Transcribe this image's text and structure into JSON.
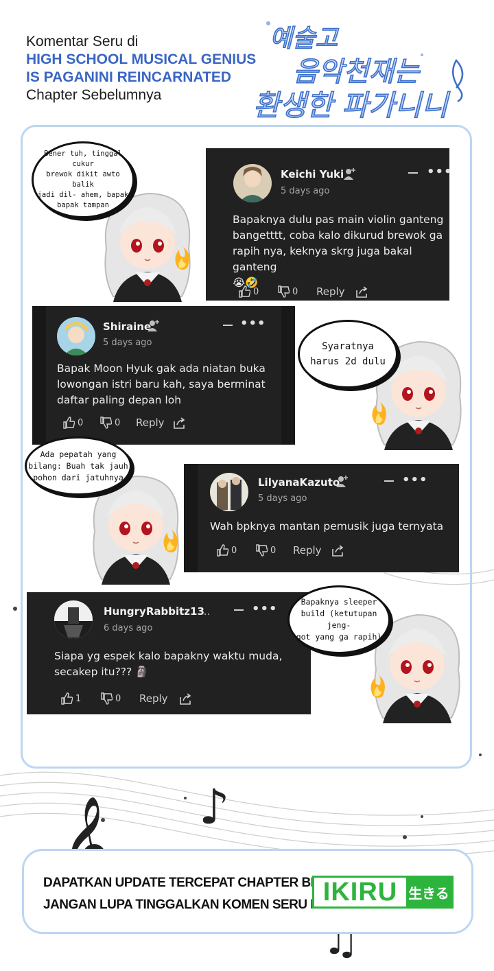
{
  "header": {
    "line1": "Komentar Seru di",
    "series_line1": "HIGH SCHOOL MUSICAL GENIUS",
    "series_line2": "IS PAGANINI REINCARNATED",
    "line4": "Chapter Sebelumnya",
    "logo_line1": "예술고",
    "logo_line2": "음악천재는",
    "logo_line3": "환생한 파가니니"
  },
  "comments": [
    {
      "username": "Keichi Yuki",
      "age": "5 days ago",
      "text_lines": [
        "Bapaknya dulu pas main violin ganteng",
        "bangetttt, coba kalo dikurud brewok ga",
        "rapih nya, keknya skrg juga bakal ganteng",
        "😭🤣"
      ],
      "likes": "0",
      "dislikes": "0",
      "reply_label": "Reply"
    },
    {
      "username": "Shiraine",
      "age": "5 days ago",
      "text_lines": [
        "Bapak Moon Hyuk gak ada niatan buka",
        "lowongan istri baru kah, saya berminat",
        "daftar paling depan loh"
      ],
      "likes": "0",
      "dislikes": "0",
      "reply_label": "Reply"
    },
    {
      "username": "LilyanaKazuto",
      "age": "5 days ago",
      "text_lines": [
        "Wah bpknya mantan pemusik juga ternyata"
      ],
      "likes": "0",
      "dislikes": "0",
      "reply_label": "Reply"
    },
    {
      "username": "HungryRabbitz13",
      "username_suffix": "...",
      "age": "6 days ago",
      "text_lines": [
        "Siapa yg espek kalo bapakny waktu muda,",
        "secakep itu??? 🗿"
      ],
      "likes": "1",
      "dislikes": "0",
      "reply_label": "Reply"
    }
  ],
  "bubbles": [
    {
      "lines": [
        "Bener tuh, tinggal cukur",
        "brewok dikit awto balik",
        "jadi dil- ahem, bapak",
        "bapak tampan"
      ]
    },
    {
      "lines": [
        "Syaratnya",
        "harus 2d dulu"
      ]
    },
    {
      "lines": [
        "Ada pepatah yang",
        "bilang: Buah tak jauh",
        "pohon dari jatuhnya"
      ]
    },
    {
      "lines": [
        "Bapaknya sleeper",
        "build (ketutupan jeng-",
        "got yang ga rapih)"
      ]
    }
  ],
  "footer": {
    "line1": "DAPATKAN UPDATE TERCEPAT CHAPTER BERIKUTNYA DI",
    "line2": "JANGAN LUPA TINGGALKAN KOMEN SERU BIAR DI NOTIS",
    "brand_name": "IKIRU",
    "brand_jp": "生きる",
    "brand_color": "#2db43d"
  },
  "icons": {
    "like": "thumbs-up-icon",
    "dislike": "thumbs-down-icon",
    "share": "share-icon",
    "follow": "add-user-icon",
    "more": "more-horizontal-icon",
    "collapse": "minus-icon"
  },
  "colors": {
    "card_bg": "#212121",
    "accent_blue": "#3a66c4",
    "frame_border": "#bcd6f2"
  }
}
